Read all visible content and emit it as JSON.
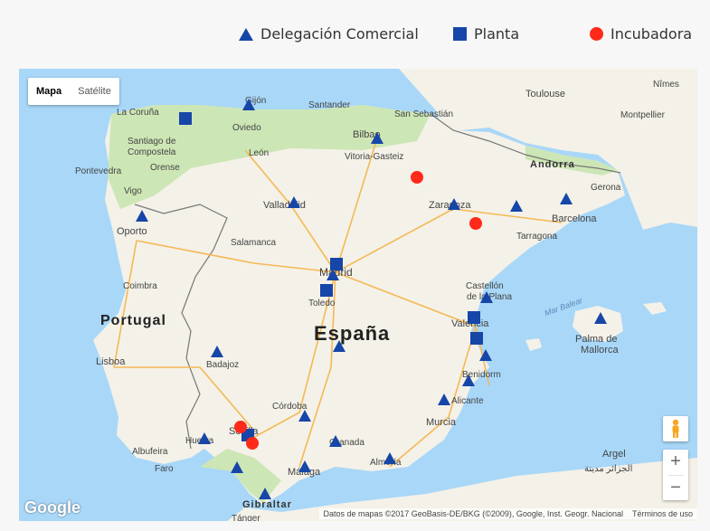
{
  "legend": {
    "delegacion": "Delegación Comercial",
    "planta": "Planta",
    "incubadora": "Incubadora"
  },
  "colors": {
    "marker_blue": "#1646a8",
    "marker_red": "#ff2a1a",
    "sea": "#a8d7f8",
    "land": "#f4f1e8",
    "green": "#cde6b5"
  },
  "map": {
    "map_type": {
      "mapa": "Mapa",
      "satelite": "Satélite",
      "selected": "Mapa"
    },
    "zoom_in": "+",
    "zoom_out": "−",
    "google_logo": "Google",
    "attribution": "Datos de mapas ©2017 GeoBasis-DE/BKG (©2009), Google, Inst. Geogr. Nacional",
    "terms": "Términos de uso",
    "labels": {
      "portugal": "Portugal",
      "espana": "España",
      "andorra": "Andorra",
      "la_coruna": "La Coruña",
      "gijon": "Gijón",
      "santander": "Santander",
      "san_sebastian": "San Sebastián",
      "toulouse": "Toulouse",
      "nimes": "Nîmes",
      "montpellier": "Montpellier",
      "oviedo": "Oviedo",
      "bilbao": "Bilbao",
      "santiago": "Santiago de",
      "compostela": "Compostela",
      "leon": "León",
      "vitoria": "Vitoria-Gasteiz",
      "pontevedra": "Pontevedra",
      "orense": "Orense",
      "vigo": "Vigo",
      "gerona": "Gerona",
      "zaragoza": "Zaragoza",
      "valladolid": "Valladolid",
      "oporto": "Oporto",
      "barcelona": "Barcelona",
      "tarragona": "Tarragona",
      "salamanca": "Salamanca",
      "madrid": "Madrid",
      "coimbra": "Coimbra",
      "castellon": "Castellón",
      "de_la_plana": "de la Plana",
      "toledo": "Toledo",
      "mar_balear": "Mar Balear",
      "valencia": "Valencia",
      "palma": "Palma de",
      "mallorca": "Mallorca",
      "lisboa": "Lisboa",
      "badajoz": "Badajoz",
      "benidorm": "Benidorm",
      "alicante": "Alicante",
      "cordoba": "Córdoba",
      "murcia": "Murcia",
      "sevilla": "Sevilla",
      "huelva": "Huelva",
      "granada": "Granada",
      "albufeira": "Albufeira",
      "almeria": "Almería",
      "argel": "Argel",
      "argel_ar": "الجزائر مدينة",
      "faro": "Faro",
      "malaga": "Málaga",
      "gibraltar": "Gibraltar",
      "tanger": "Tánger"
    }
  },
  "markers": {
    "delegaciones": [
      "Oviedo",
      "Vitoria-Gasteiz",
      "Valladolid",
      "Oporto",
      "Zaragoza",
      "Lleida",
      "Barcelona",
      "Madrid",
      "Castellón de la Plana",
      "Palma de Mallorca",
      "Badajoz",
      "Ciudad Real",
      "Benidorm",
      "Alicante",
      "Murcia",
      "Córdoba",
      "Huelva",
      "Granada",
      "Almería",
      "Málaga",
      "Cádiz",
      "Gibraltar"
    ],
    "plantas": [
      "Lugo",
      "Madrid",
      "Toledo",
      "Valencia",
      "Valencia sur",
      "Sevilla"
    ],
    "incubadoras": [
      "Logroño",
      "Zaragoza sur",
      "Sevilla",
      "Sevilla sur"
    ]
  }
}
